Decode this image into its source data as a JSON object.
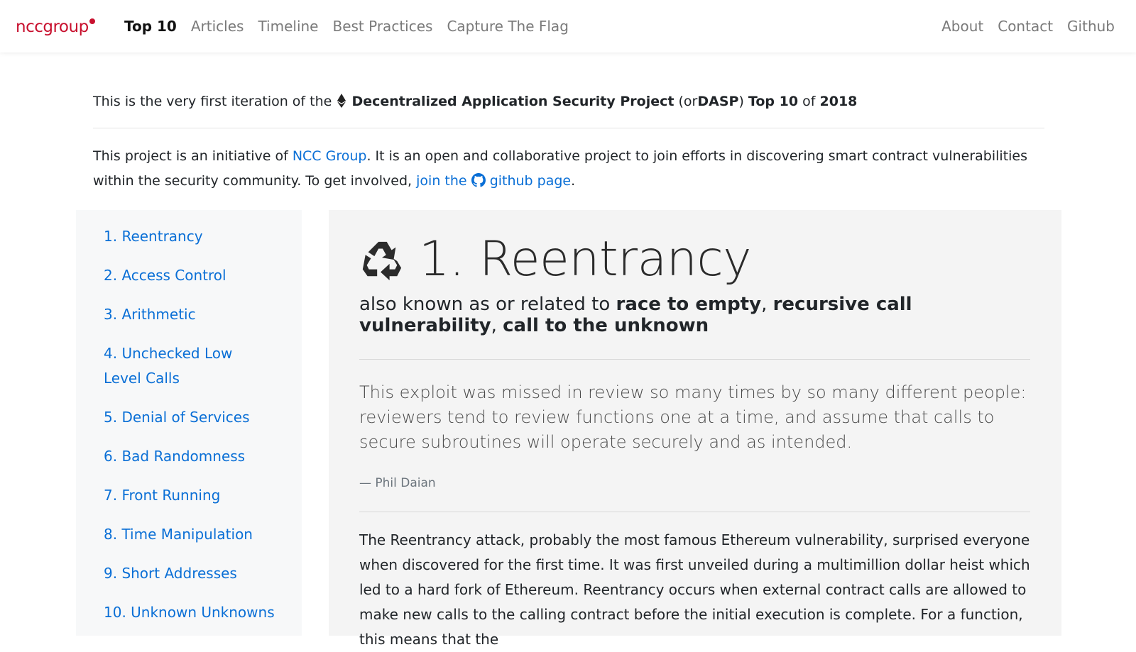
{
  "brand": {
    "logo_text": "nccgroup",
    "color": "#c8102e"
  },
  "nav": {
    "left": [
      "Top 10",
      "Articles",
      "Timeline",
      "Best Practices",
      "Capture The Flag"
    ],
    "right": [
      "About",
      "Contact",
      "Github"
    ],
    "active": "Top 10"
  },
  "intro": {
    "prefix": "This is the very first iteration of the",
    "project_name": "Decentralized Application Security Project",
    "paren_open": "(or",
    "acronym": "DASP",
    "paren_close": ")",
    "top10": "Top 10",
    "of": "of",
    "year": "2018"
  },
  "initiative": {
    "prefix": "This project is an initiative of",
    "ncc_link": "NCC Group",
    "middle": ". It is an open and collaborative project to join efforts in discovering smart contract vulnerabilities within the security community. To get involved,",
    "join_link": "join the",
    "github_link": "github page",
    "suffix": "."
  },
  "sidebar": {
    "items": [
      "1. Reentrancy",
      "2. Access Control",
      "3. Arithmetic",
      "4. Unchecked Low Level Calls",
      "5. Denial of Services",
      "6. Bad Randomness",
      "7. Front Running",
      "8. Time Manipulation",
      "9. Short Addresses",
      "10. Unknown Unknowns"
    ]
  },
  "article": {
    "icon": "recycle-icon",
    "title": "1. Reentrancy",
    "aka_prefix": "also known as or related to",
    "aka_terms": [
      "race to empty",
      "recursive call vulnerability",
      "call to the unknown"
    ],
    "quote": "This exploit was missed in review so many times by so many different people: reviewers tend to review functions one at a time, and assume that calls to secure subroutines will operate securely and as intended.",
    "quote_author": "— Phil Daian",
    "body": "The Reentrancy attack, probably the most famous Ethereum vulnerability, surprised everyone when discovered for the first time. It was first unveiled during a multimillion dollar heist which led to a hard fork of Ethereum. Reentrancy occurs when external contract calls are allowed to make new calls to the calling contract before the initial execution is complete. For a function, this means that the"
  },
  "colors": {
    "link": "#0a6fd6",
    "sidebar_bg": "#f7f8f9",
    "card_bg": "#f4f4f4"
  }
}
